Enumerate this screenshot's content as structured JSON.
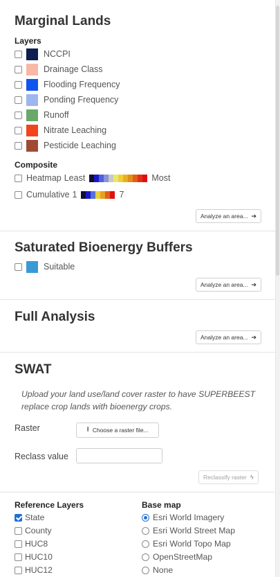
{
  "marginal": {
    "title": "Marginal Lands",
    "layers_heading": "Layers",
    "layers": [
      {
        "label": "NCCPI",
        "color": "#0c1f4d"
      },
      {
        "label": "Drainage Class",
        "color": "#f8b8a5"
      },
      {
        "label": "Flooding Frequency",
        "color": "#1155ee"
      },
      {
        "label": "Ponding Frequency",
        "color": "#9db6ef"
      },
      {
        "label": "Runoff",
        "color": "#68a96b"
      },
      {
        "label": "Nitrate Leaching",
        "color": "#f2441d"
      },
      {
        "label": "Pesticide Leaching",
        "color": "#a04a33"
      }
    ],
    "composite_heading": "Composite",
    "heatmap_label": "Heatmap",
    "heatmap_least": "Least",
    "heatmap_most": "Most",
    "heatmap_colors": [
      "#10102e",
      "#1a1ac8",
      "#4a63d8",
      "#8a92d8",
      "#c8c8c8",
      "#e8e870",
      "#f0d038",
      "#e8b020",
      "#e09018",
      "#e06018",
      "#e03018",
      "#e01010"
    ],
    "cumulative_label": "Cumulative",
    "cumulative_min": "1",
    "cumulative_max": "7",
    "cumulative_colors": [
      "#10102e",
      "#1a1ac8",
      "#5870d8",
      "#e8d040",
      "#e8a020",
      "#e06018",
      "#e01010"
    ],
    "analyze_label": "Analyze an area..."
  },
  "buffers": {
    "title": "Saturated Bioenergy Buffers",
    "layer": {
      "label": "Suitable",
      "color": "#3a9ad6"
    },
    "analyze_label": "Analyze an area..."
  },
  "full": {
    "title": "Full Analysis",
    "analyze_label": "Analyze an area..."
  },
  "swat": {
    "title": "SWAT",
    "description": "Upload your land use/land cover raster to have SUPERBEEST replace crop lands with bioenergy crops.",
    "raster_label": "Raster",
    "choose_button": "Choose a raster file...",
    "reclass_label": "Reclass value",
    "reclass_value": "",
    "reclassify_button": "Reclassify raster"
  },
  "reference": {
    "heading": "Reference Layers",
    "items": [
      {
        "label": "State",
        "checked": true
      },
      {
        "label": "County",
        "checked": false
      },
      {
        "label": "HUC8",
        "checked": false
      },
      {
        "label": "HUC10",
        "checked": false
      },
      {
        "label": "HUC12",
        "checked": false
      }
    ]
  },
  "basemap": {
    "heading": "Base map",
    "options": [
      {
        "label": "Esri World Imagery",
        "selected": true
      },
      {
        "label": "Esri World Street Map",
        "selected": false
      },
      {
        "label": "Esri World Topo Map",
        "selected": false
      },
      {
        "label": "OpenStreetMap",
        "selected": false
      },
      {
        "label": "None",
        "selected": false
      }
    ]
  }
}
